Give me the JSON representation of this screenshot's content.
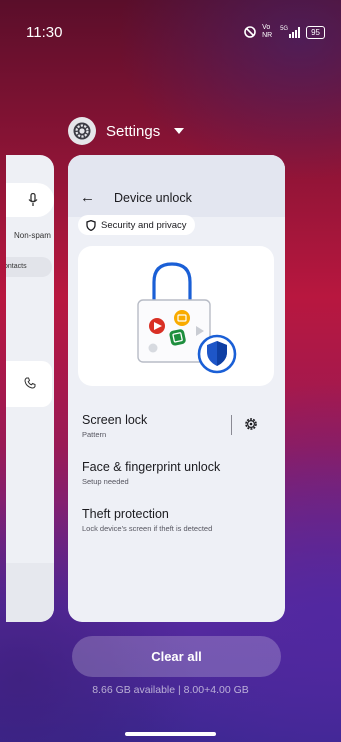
{
  "status_bar": {
    "time": "11:30",
    "network_label": "Vo NR",
    "signal_label": "5G",
    "battery": "95"
  },
  "recents": {
    "app_name": "Settings",
    "clear_all_label": "Clear all",
    "memory_text": "8.66 GB available | 8.00+4.00 GB"
  },
  "left_card": {
    "chip_nonspam": "Non-spam",
    "chip_contacts": "ontacts"
  },
  "settings_card": {
    "title": "Device unlock",
    "chip_label": "Security and privacy",
    "items": [
      {
        "title": "Screen lock",
        "subtitle": "Pattern"
      },
      {
        "title": "Face & fingerprint unlock",
        "subtitle": "Setup needed"
      },
      {
        "title": "Theft protection",
        "subtitle": "Lock device's screen if theft is detected"
      }
    ]
  },
  "colors": {
    "card_bg": "#eef0f6",
    "lock_blue": "#1a5fd6",
    "shield_blue": "#1e56c8",
    "red_dot": "#d93025",
    "yellow_dot": "#f9ab00",
    "green_dot": "#1e8e3e"
  }
}
